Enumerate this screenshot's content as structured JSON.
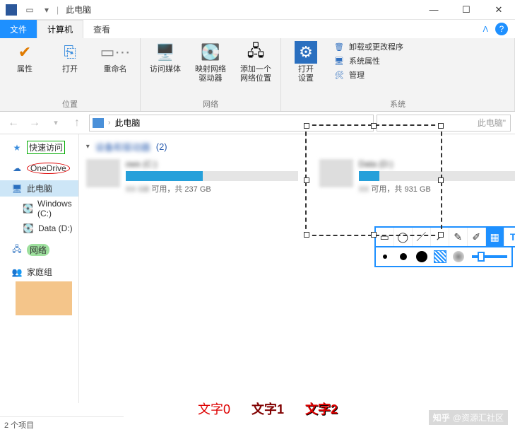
{
  "title": "此电脑",
  "tabs": {
    "file": "文件",
    "computer": "计算机",
    "view": "查看"
  },
  "ribbon": {
    "group_location": {
      "label": "位置",
      "buttons": {
        "properties": "属性",
        "open": "打开",
        "rename": "重命名"
      }
    },
    "group_network": {
      "label": "网络",
      "buttons": {
        "media": "访问媒体",
        "mapdrive": "映射网络\n驱动器",
        "addloc": "添加一个\n网络位置"
      }
    },
    "group_system": {
      "label": "系统",
      "open_settings": "打开\n设置",
      "items": {
        "uninstall": "卸载或更改程序",
        "sysprops": "系统属性",
        "manage": "管理"
      }
    }
  },
  "address": {
    "location": "此电脑",
    "search_hint": "此电脑\""
  },
  "sidebar": {
    "quickaccess": "快速访问",
    "onedrive": "OneDrive",
    "thispc": "此电脑",
    "c": "Windows (C:)",
    "d": "Data (D:)",
    "network": "网络",
    "homegroup": "家庭组"
  },
  "content": {
    "heading_count": "(2)",
    "drive_c": {
      "name": "ows (C:)",
      "cap_suffix": "可用，共 237 GB",
      "fill_pct": 45
    },
    "drive_d": {
      "cap_suffix": "可用，共 931 GB",
      "fill_pct": 12
    }
  },
  "annotations": {
    "t0": "文字0",
    "t1": "文字1",
    "t2": "文字2"
  },
  "watermark": {
    "brand": "知乎",
    "author": "@资源汇社区"
  },
  "status": "2 个项目"
}
